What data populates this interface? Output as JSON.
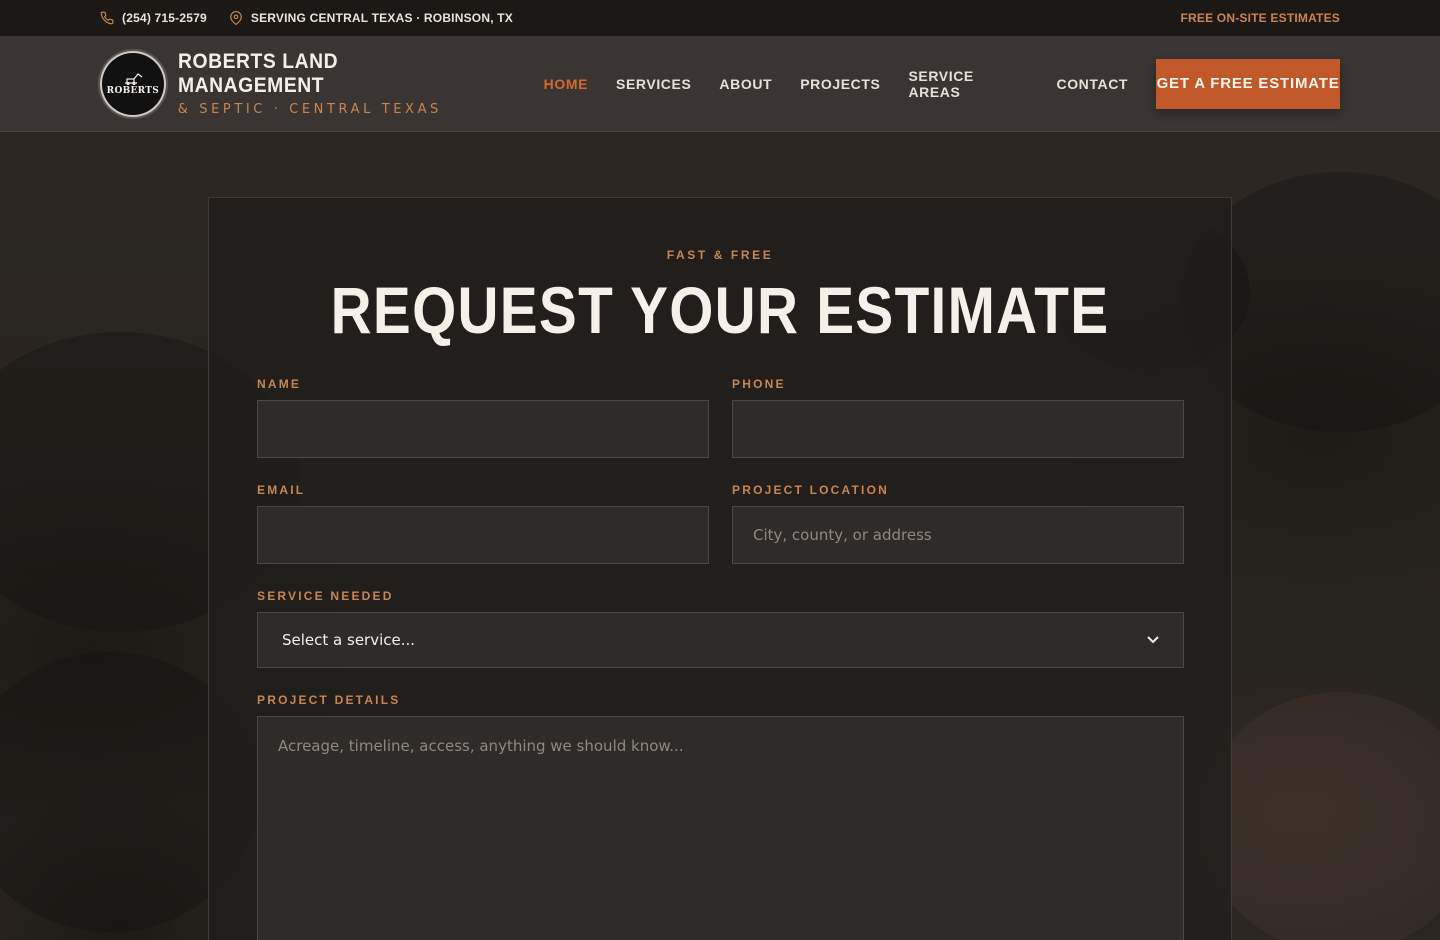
{
  "topbar": {
    "phone": "(254) 715-2579",
    "service_area": "SERVING CENTRAL TEXAS · ROBINSON, TX",
    "promo": "FREE ON-SITE ESTIMATES"
  },
  "header": {
    "logo_text": "ROBERTS",
    "brand_name": "ROBERTS LAND MANAGEMENT",
    "brand_tagline": "& SEPTIC · CENTRAL TEXAS",
    "nav": [
      {
        "label": "HOME",
        "active": true
      },
      {
        "label": "SERVICES"
      },
      {
        "label": "ABOUT"
      },
      {
        "label": "PROJECTS"
      },
      {
        "label": "SERVICE AREAS"
      },
      {
        "label": "CONTACT"
      }
    ],
    "cta_label": "GET A FREE ESTIMATE"
  },
  "form": {
    "eyebrow": "FAST & FREE",
    "title": "REQUEST YOUR ESTIMATE",
    "name_label": "NAME",
    "name_value": "",
    "phone_label": "PHONE",
    "phone_value": "",
    "email_label": "EMAIL",
    "email_value": "",
    "location_label": "PROJECT LOCATION",
    "location_placeholder": "City, county, or address",
    "service_label": "SERVICE NEEDED",
    "service_selected": "Select a service...",
    "details_label": "PROJECT DETAILS",
    "details_placeholder": "Acreage, timeline, access, anything we should know..."
  },
  "colors": {
    "accent": "#c0582a",
    "accent_text": "#c9854f",
    "active_nav": "#d4692f"
  },
  "icons": {
    "phone": "phone-icon",
    "location": "map-pin-icon",
    "select": "chevron-down-icon"
  }
}
